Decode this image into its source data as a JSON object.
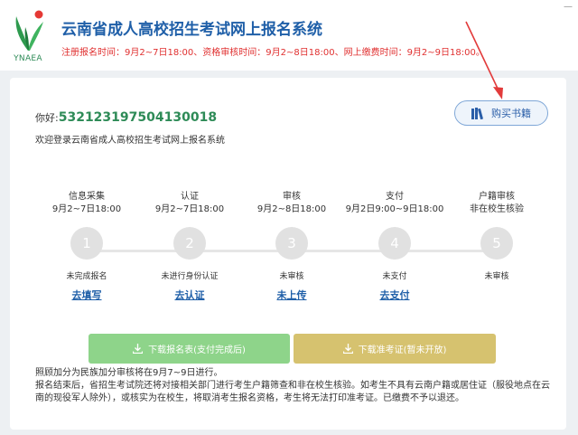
{
  "header": {
    "logo_text": "YNAEA",
    "title": "云南省成人高校招生考试网上报名系统",
    "notice": "注册报名时间：9月2~7日18:00、资格审核时间：9月2~8日18:00、网上缴费时间：9月2~9日18:00。"
  },
  "user": {
    "greeting": "你好:",
    "id": "532123197504130018",
    "welcome": "欢迎登录云南省成人高校招生考试网上报名系统"
  },
  "buy_books": {
    "label": "购买书籍",
    "icon": "books-icon"
  },
  "steps": [
    {
      "name": "信息采集",
      "time": "9月2~7日18:00",
      "number": "1",
      "status": "未完成报名",
      "action": "去填写"
    },
    {
      "name": "认证",
      "time": "9月2~7日18:00",
      "number": "2",
      "status": "未进行身份认证",
      "action": "去认证"
    },
    {
      "name": "审核",
      "time": "9月2~8日18:00",
      "number": "3",
      "status": "未审核",
      "action": "未上传"
    },
    {
      "name": "支付",
      "time": "9月2日9:00~9日18:00",
      "number": "4",
      "status": "未支付",
      "action": "去支付"
    },
    {
      "name": "户籍审核",
      "time": "非在校生核验",
      "number": "5",
      "status": "未审核",
      "action": ""
    }
  ],
  "downloads": {
    "form": "下载报名表(支付完成后)",
    "ticket": "下载准考证(暂未开放)"
  },
  "notes": [
    "照顾加分为民族加分审核将在9月7~9日进行。",
    "报名结束后，省招生考试院还将对接相关部门进行考生户籍筛查和非在校生核验。如考生不具有云南户籍或居住证（服役地点在云南的现役军人除外），或核实为在校生，将取消考生报名资格，考生将无法打印准考证。已缴费不予以退还。"
  ],
  "colors": {
    "title_blue": "#1f5fa8",
    "notice_red": "#e03030",
    "id_green": "#2e8b57",
    "download_green": "#8ed48a",
    "download_gold": "#d6c26f",
    "arrow_red": "#e23b3b"
  }
}
